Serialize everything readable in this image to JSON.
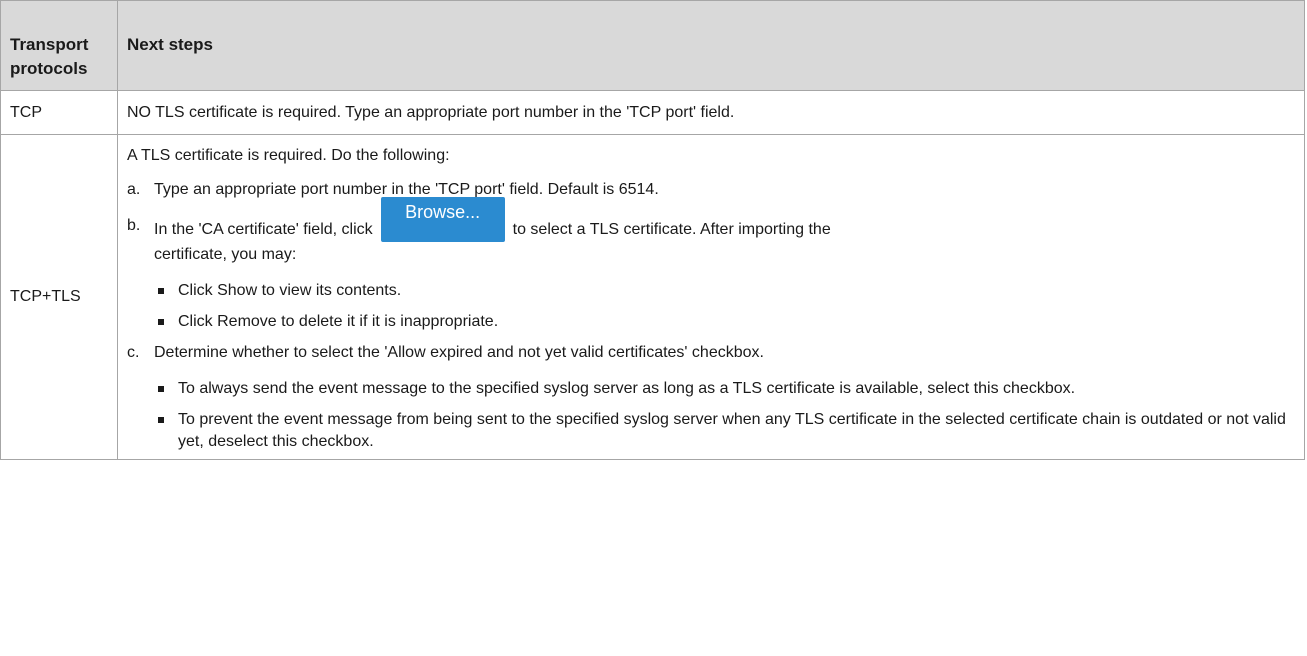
{
  "header": {
    "protocol_col": "Transport protocols",
    "steps_col": "Next steps"
  },
  "rows": [
    {
      "protocol": "TCP",
      "text": "NO TLS certificate is required. Type an appropriate port number in the 'TCP port' field."
    },
    {
      "protocol": "TCP+TLS",
      "intro": "A TLS certificate is required. Do the following:",
      "steps": [
        {
          "marker": "a.",
          "text": "Type an appropriate port number in the 'TCP port' field. Default is 6514."
        },
        {
          "marker": "b.",
          "text_before": "In the 'CA certificate' field, click",
          "button_label": "Browse...",
          "text_after": "to select a TLS certificate. After importing the",
          "text_cont": "certificate, you may:",
          "bullets": [
            "Click Show to view its contents.",
            "Click Remove to delete it if it is inappropriate."
          ]
        },
        {
          "marker": "c.",
          "text": "Determine whether to select the 'Allow expired and not yet valid certificates' checkbox.",
          "bullets": [
            "To always send the event message to the specified syslog server as long as a TLS certificate is available, select this checkbox.",
            "To prevent the event message from being sent to the specified syslog server when any TLS certificate in the selected certificate chain is outdated or not valid yet, deselect this checkbox."
          ]
        }
      ]
    }
  ],
  "colors": {
    "header_bg": "#d9d9d9",
    "border": "#a6a6a6",
    "button_bg": "#2b8bd0"
  }
}
